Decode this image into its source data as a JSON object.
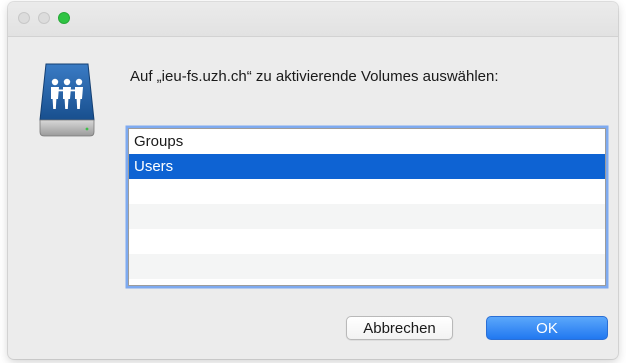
{
  "window": {
    "controls": [
      "close",
      "minimize",
      "zoom"
    ],
    "zoom_color": "#2fc443"
  },
  "icon": "shared-server-icon",
  "prompt": "Auf „ieu-fs.uzh.ch“ zu aktivierende Volumes auswählen:",
  "volumes": {
    "items": [
      {
        "label": "Groups",
        "selected": false
      },
      {
        "label": "Users",
        "selected": true
      },
      {
        "label": "",
        "selected": false
      },
      {
        "label": "",
        "selected": false
      },
      {
        "label": "",
        "selected": false
      },
      {
        "label": "",
        "selected": false
      }
    ],
    "selection_color": "#0e63d3"
  },
  "buttons": {
    "cancel_label": "Abbrechen",
    "ok_label": "OK"
  }
}
